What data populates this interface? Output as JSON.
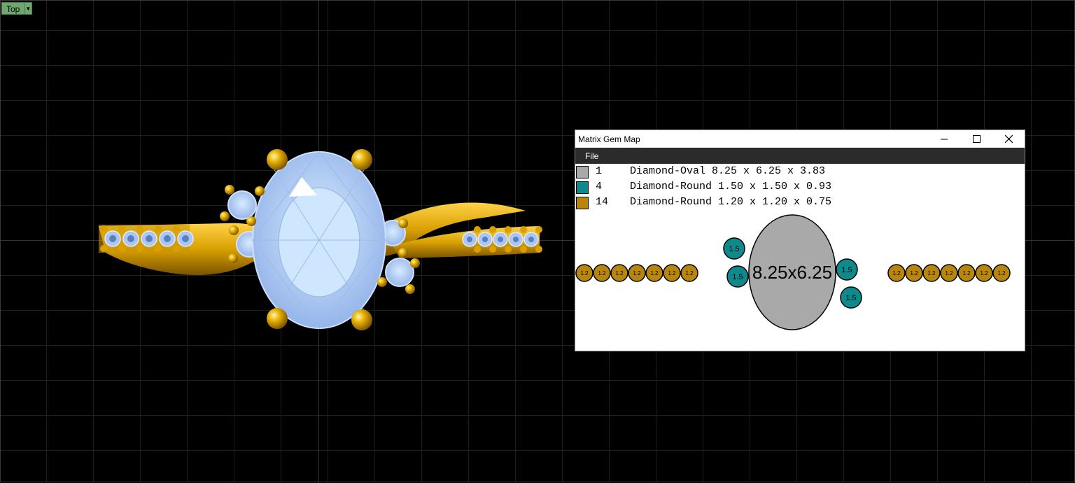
{
  "viewport": {
    "view_label": "Top",
    "grid_color": "#1e1e1e",
    "background": "#000000"
  },
  "gem_map_window": {
    "title": "Matrix Gem Map",
    "controls": [
      "minimize-icon",
      "maximize-icon",
      "close-icon"
    ],
    "menu": [
      "File"
    ],
    "legend": [
      {
        "color": "#a9a9a9",
        "count": "1",
        "description": "Diamond-Oval 8.25 x 6.25 x 3.83"
      },
      {
        "color": "#0e8a8c",
        "count": "4",
        "description": "Diamond-Round 1.50 x 1.50 x 0.93"
      },
      {
        "color": "#b8860b",
        "count": "14",
        "description": "Diamond-Round 1.20 x 1.20 x 0.75"
      }
    ],
    "map": {
      "center_label": "8.25x6.25",
      "accent_label": "1.5",
      "small_label": "1.2"
    }
  },
  "colors": {
    "gold": "#d9a100",
    "gold_dark": "#a06e00",
    "gem_blue": "#a9c6f5",
    "gem_outline": "#cfe0ff"
  }
}
